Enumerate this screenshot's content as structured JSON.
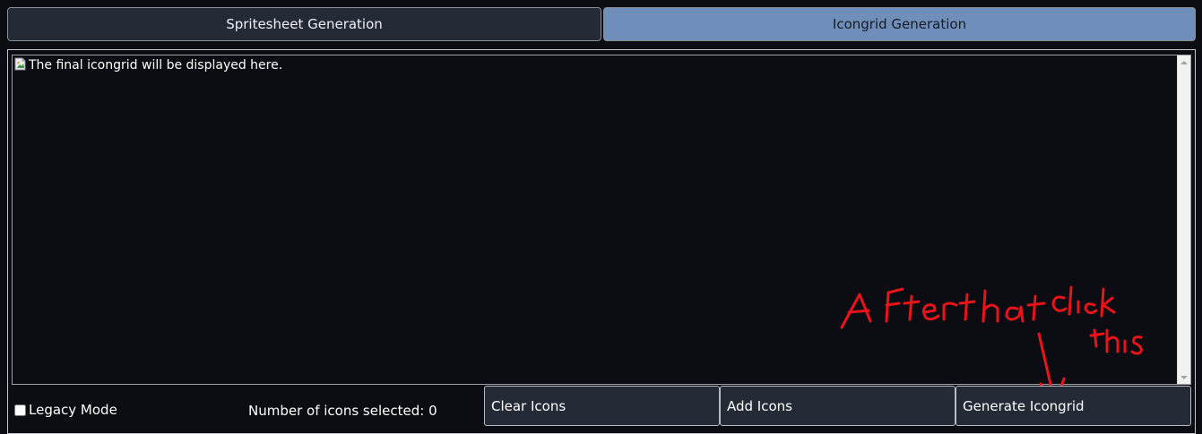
{
  "tabs": [
    {
      "label": "Spritesheet Generation",
      "active": false
    },
    {
      "label": "Icongrid Generation",
      "active": true
    }
  ],
  "display": {
    "alt_text": "The final icongrid will be displayed here."
  },
  "controls": {
    "legacy_label": "Legacy Mode",
    "legacy_checked": false,
    "counter_text": "Number of icons selected: 0",
    "clear_label": "Clear Icons",
    "add_label": "Add Icons",
    "generate_label": "Generate Icongrid"
  },
  "annotation": {
    "text": "After that click this",
    "color": "#e8141a"
  },
  "colors": {
    "background": "#0b0d12",
    "tab_inactive": "#252a37",
    "tab_active": "#6f8fba",
    "button_bg": "#252a37"
  }
}
